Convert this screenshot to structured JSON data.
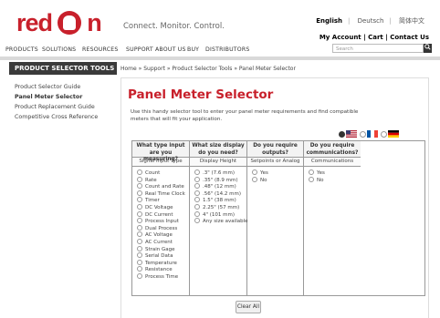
{
  "header": {
    "logo_text_a": "red",
    "logo_text_b": "n",
    "tagline": "Connect. Monitor. Control.",
    "languages": [
      "English",
      "Deutsch",
      "简体中文"
    ],
    "account": [
      "My Account",
      "Cart",
      "Contact Us"
    ],
    "search_placeholder": "Search"
  },
  "nav": [
    "PRODUCTS",
    "SOLUTIONS",
    "RESOURCES",
    "SUPPORT",
    "ABOUT US",
    "BUY",
    "DISTRIBUTORS"
  ],
  "sidebar": {
    "title": "PRODUCT SELECTOR TOOLS",
    "items": [
      "Product Selector Guide",
      "Panel Meter Selector",
      "Product Replacement Guide",
      "Competitive Cross Reference"
    ]
  },
  "main": {
    "breadcrumb": "Home » Support » Product Selector Tools » Panel Meter Selector",
    "title": "Panel Meter Selector",
    "description": "Use this handy selector tool to enter your panel meter requirements and find compatible meters that will fit your application.",
    "clear_label": "Clear All"
  },
  "selector": {
    "col1": {
      "head": "What type input are you measuring?",
      "sub": "Signal Input Type",
      "options": [
        "Count",
        "Rate",
        "Count and Rate",
        "Real Time Clock",
        "Timer",
        "DC Voltage",
        "DC Current",
        "Process Input",
        "Dual Process",
        "AC Voltage",
        "AC Current",
        "Strain Gage",
        "Serial Data",
        "Temperature",
        "Resistance",
        "Process Time"
      ]
    },
    "col2": {
      "head": "What size display do you need?",
      "sub": "Display Height",
      "options": [
        ".3\" (7.6 mm)",
        ".35\" (8.9 mm)",
        ".48\" (12 mm)",
        ".56\" (14.2 mm)",
        "1.5\" (38 mm)",
        "2.25\" (57 mm)",
        "4\" (101 mm)",
        "Any size available"
      ]
    },
    "col3": {
      "head": "Do you require outputs?",
      "sub": "Setpoints or Analog",
      "options": [
        "Yes",
        "No"
      ]
    },
    "col4": {
      "head": "Do you require communications?",
      "sub": "Communications",
      "options": [
        "Yes",
        "No"
      ]
    }
  },
  "colors": {
    "brand_red": "#c8202b",
    "sidebar_dark": "#3a3a3a"
  }
}
